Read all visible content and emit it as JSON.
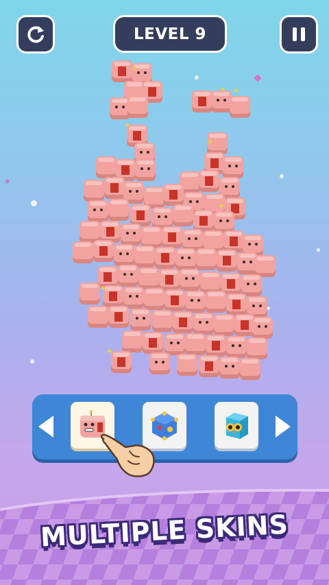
{
  "hud": {
    "level_label": "LEVEL 9",
    "restart_icon": "restart-icon",
    "pause_icon": "pause-icon"
  },
  "skins": {
    "prev_icon": "triangle-left-icon",
    "next_icon": "triangle-right-icon",
    "items": [
      {
        "name": "pink-face-cube",
        "selected": true
      },
      {
        "name": "blue-geo-cube",
        "selected": false
      },
      {
        "name": "cyan-owl-cube",
        "selected": false
      }
    ],
    "pointer_icon": "hand-pointer-icon"
  },
  "banner": {
    "text": "MULTIPLE SKINS"
  },
  "colors": {
    "cube": "#f2a3a0",
    "cube_shade": "#d98682",
    "cube_mark": "#c8342a",
    "hud_bg": "#343e5c",
    "panel": "#3f86d6",
    "banner_outline": "#3b2a78"
  }
}
